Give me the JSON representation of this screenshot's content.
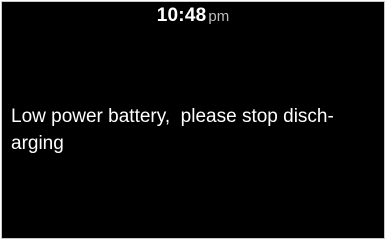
{
  "status_bar": {
    "time": "10:48",
    "period": "pm"
  },
  "alert": {
    "line1": "Low power battery,  please stop disch-",
    "line2": "arging"
  },
  "colors": {
    "screen_background": "#000000",
    "text": "#ffffff",
    "period_text": "#bdbdbd",
    "frame_border": "#c8c8c8"
  }
}
